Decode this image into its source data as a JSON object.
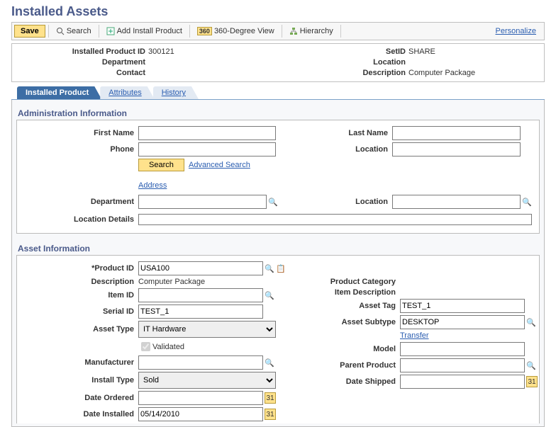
{
  "page_title": "Installed Assets",
  "toolbar": {
    "save": "Save",
    "search": "Search",
    "add_install_product": "Add Install Product",
    "view_360": "360-Degree View",
    "hierarchy": "Hierarchy",
    "personalize": "Personalize"
  },
  "header": {
    "installed_product_id_label": "Installed Product ID",
    "installed_product_id_value": "300121",
    "department_label": "Department",
    "department_value": "",
    "contact_label": "Contact",
    "contact_value": "",
    "setid_label": "SetID",
    "setid_value": "SHARE",
    "location_label": "Location",
    "location_value": "",
    "description_label": "Description",
    "description_value": "Computer Package"
  },
  "tabs": {
    "installed_product": "Installed Product",
    "attributes": "Attributes",
    "history": "History"
  },
  "admin": {
    "section_title": "Administration Information",
    "first_name_label": "First Name",
    "first_name_value": "",
    "last_name_label": "Last Name",
    "last_name_value": "",
    "phone_label": "Phone",
    "phone_value": "",
    "location_label": "Location",
    "location_value": "",
    "search_button": "Search",
    "advanced_search": "Advanced Search",
    "address": "Address",
    "department_label": "Department",
    "department_value": "",
    "location2_label": "Location",
    "location2_value": "",
    "location_details_label": "Location Details",
    "location_details_value": ""
  },
  "asset": {
    "section_title": "Asset Information",
    "product_id_label": "Product ID",
    "product_id_value": "USA100",
    "description_label": "Description",
    "description_value": "Computer Package",
    "product_category_label": "Product Category",
    "item_id_label": "Item ID",
    "item_id_value": "",
    "item_description_label": "Item Description",
    "serial_id_label": "Serial ID",
    "serial_id_value": "TEST_1",
    "asset_tag_label": "Asset Tag",
    "asset_tag_value": "TEST_1",
    "asset_type_label": "Asset Type",
    "asset_type_value": "IT Hardware",
    "asset_subtype_label": "Asset Subtype",
    "asset_subtype_value": "DESKTOP",
    "validated_label": "Validated",
    "transfer_link": "Transfer",
    "manufacturer_label": "Manufacturer",
    "manufacturer_value": "",
    "model_label": "Model",
    "model_value": "",
    "install_type_label": "Install Type",
    "install_type_value": "Sold",
    "parent_product_label": "Parent Product",
    "parent_product_value": "",
    "date_ordered_label": "Date Ordered",
    "date_ordered_value": "",
    "date_shipped_label": "Date Shipped",
    "date_shipped_value": "",
    "date_installed_label": "Date Installed",
    "date_installed_value": "05/14/2010"
  }
}
